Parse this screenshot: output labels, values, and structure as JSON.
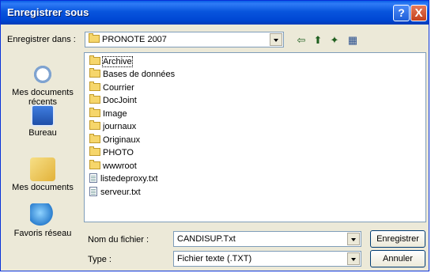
{
  "title": "Enregistrer sous",
  "help_label": "?",
  "close_label": "X",
  "save_in_label": "Enregistrer dans :",
  "save_in_value": "PRONOTE 2007",
  "places": [
    {
      "label": "Mes documents récents",
      "icon": "recent-documents-icon"
    },
    {
      "label": "Bureau",
      "icon": "desktop-icon"
    },
    {
      "label": "Mes documents",
      "icon": "my-documents-icon"
    },
    {
      "label": "Favoris réseau",
      "icon": "network-icon"
    }
  ],
  "files": [
    {
      "name": "Archive",
      "type": "folder"
    },
    {
      "name": "Bases de données",
      "type": "folder"
    },
    {
      "name": "Courrier",
      "type": "folder"
    },
    {
      "name": "DocJoint",
      "type": "folder"
    },
    {
      "name": "Image",
      "type": "folder"
    },
    {
      "name": "journaux",
      "type": "folder"
    },
    {
      "name": "Originaux",
      "type": "folder"
    },
    {
      "name": "PHOTO",
      "type": "folder"
    },
    {
      "name": "wwwroot",
      "type": "folder"
    },
    {
      "name": "listedeproxy.txt",
      "type": "file"
    },
    {
      "name": "serveur.txt",
      "type": "file"
    }
  ],
  "filename_label": "Nom du fichier :",
  "filename_value": "CANDISUP.Txt",
  "type_label": "Type :",
  "type_value": "Fichier texte (.TXT)",
  "save_button": "Enregistrer",
  "cancel_button": "Annuler"
}
